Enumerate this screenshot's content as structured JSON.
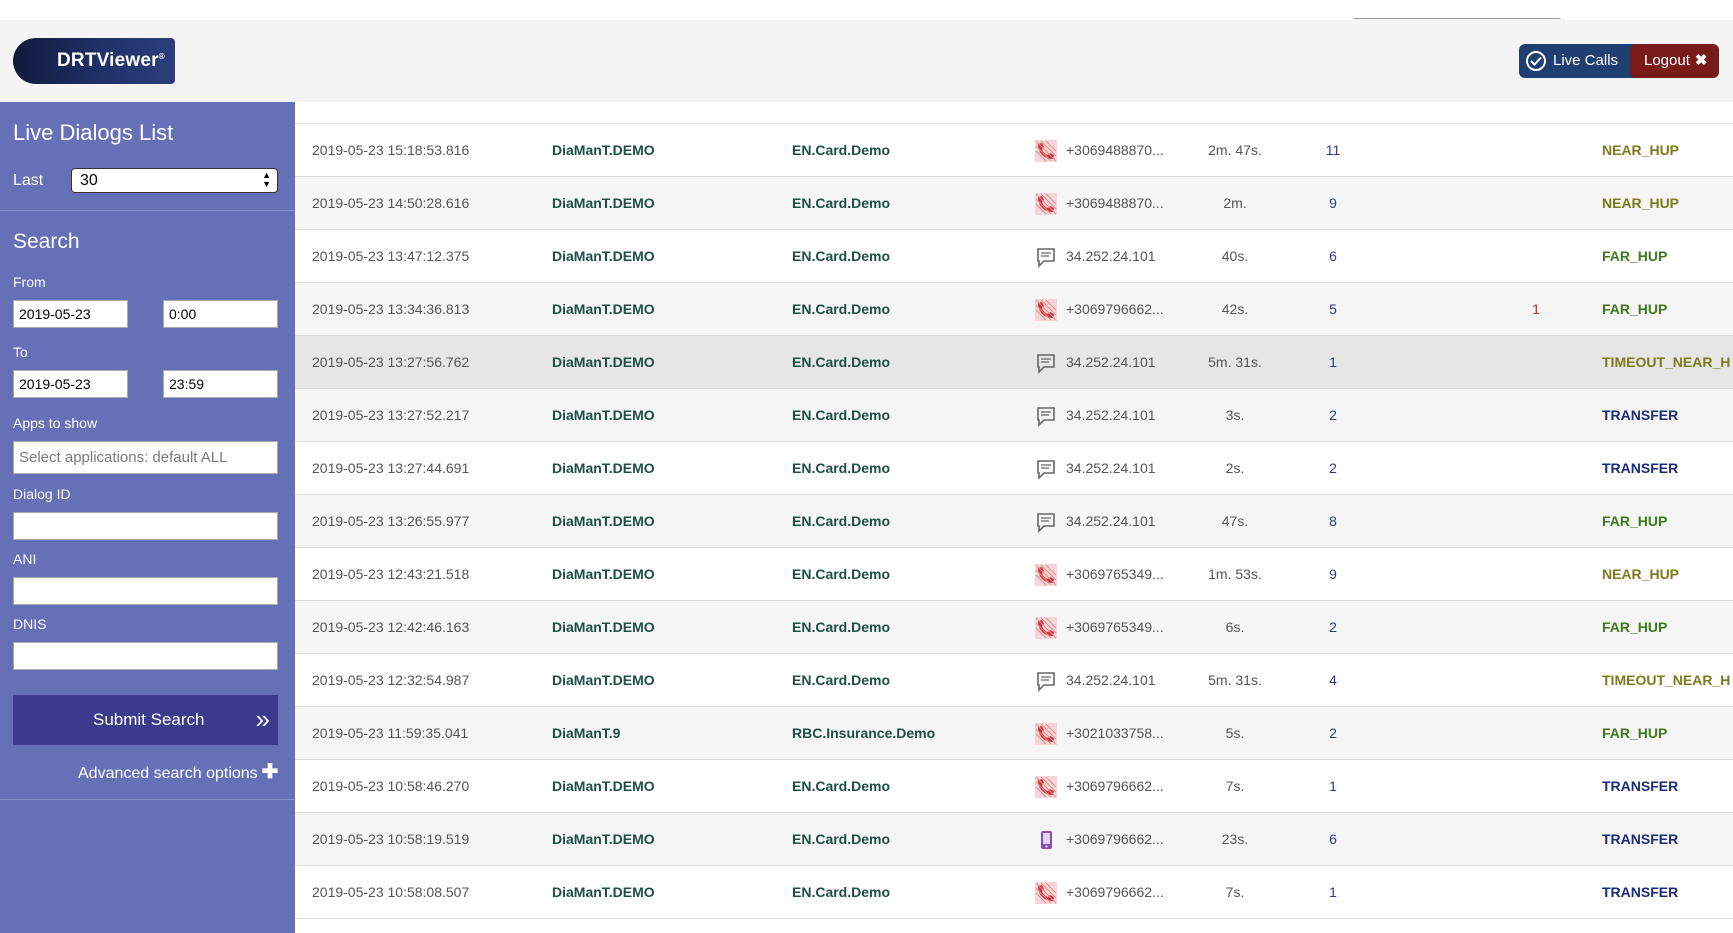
{
  "header": {
    "logo_text": "DRTViewer",
    "logo_mark": "®",
    "live_calls_label": "Live Calls",
    "logout_label": "Logout",
    "logout_icon": "✖"
  },
  "sidebar": {
    "title": "Live Dialogs List",
    "last_label": "Last",
    "last_value": "30",
    "search_title": "Search",
    "from_label": "From",
    "from_date": "2019-05-23",
    "from_time": "0:00",
    "to_label": "To",
    "to_date": "2019-05-23",
    "to_time": "23:59",
    "apps_label": "Apps to show",
    "apps_placeholder": "Select applications: default ALL",
    "dialog_id_label": "Dialog ID",
    "dialog_id_value": "",
    "ani_label": "ANI",
    "ani_value": "",
    "dnis_label": "DNIS",
    "dnis_value": "",
    "submit_label": "Submit Search",
    "submit_icon": "»",
    "advanced_label": "Advanced search options",
    "advanced_icon": "✚"
  },
  "colors": {
    "sidebar_bg": "#6570b6",
    "submit_bg": "#3b3a8c",
    "live_calls_bg": "#1f3f73",
    "logout_bg": "#7a1b1b",
    "system_text": "#1d4f43"
  },
  "rows": [
    {
      "date": "2019-05-23 15:18:53.816",
      "system": "DiaManT.DEMO",
      "app": "EN.Card.Demo",
      "icon": "phone-icon",
      "ani": "+3069488870...",
      "duration": "2m. 47s.",
      "steps": "11",
      "errors": "",
      "end": "NEAR_HUP"
    },
    {
      "date": "2019-05-23 14:50:28.616",
      "system": "DiaManT.DEMO",
      "app": "EN.Card.Demo",
      "icon": "phone-icon",
      "ani": "+3069488870...",
      "duration": "2m.",
      "steps": "9",
      "errors": "",
      "end": "NEAR_HUP"
    },
    {
      "date": "2019-05-23 13:47:12.375",
      "system": "DiaManT.DEMO",
      "app": "EN.Card.Demo",
      "icon": "chat-icon",
      "ani": "34.252.24.101",
      "duration": "40s.",
      "steps": "6",
      "errors": "",
      "end": "FAR_HUP"
    },
    {
      "date": "2019-05-23 13:34:36.813",
      "system": "DiaManT.DEMO",
      "app": "EN.Card.Demo",
      "icon": "phone-icon",
      "ani": "+3069796662...",
      "duration": "42s.",
      "steps": "5",
      "errors": "1",
      "end": "FAR_HUP"
    },
    {
      "date": "2019-05-23 13:27:56.762",
      "system": "DiaManT.DEMO",
      "app": "EN.Card.Demo",
      "icon": "chat-icon",
      "ani": "34.252.24.101",
      "duration": "5m. 31s.",
      "steps": "1",
      "errors": "",
      "end": "TIMEOUT_NEAR_H"
    },
    {
      "date": "2019-05-23 13:27:52.217",
      "system": "DiaManT.DEMO",
      "app": "EN.Card.Demo",
      "icon": "chat-icon",
      "ani": "34.252.24.101",
      "duration": "3s.",
      "steps": "2",
      "errors": "",
      "end": "TRANSFER"
    },
    {
      "date": "2019-05-23 13:27:44.691",
      "system": "DiaManT.DEMO",
      "app": "EN.Card.Demo",
      "icon": "chat-icon",
      "ani": "34.252.24.101",
      "duration": "2s.",
      "steps": "2",
      "errors": "",
      "end": "TRANSFER"
    },
    {
      "date": "2019-05-23 13:26:55.977",
      "system": "DiaManT.DEMO",
      "app": "EN.Card.Demo",
      "icon": "chat-icon",
      "ani": "34.252.24.101",
      "duration": "47s.",
      "steps": "8",
      "errors": "",
      "end": "FAR_HUP"
    },
    {
      "date": "2019-05-23 12:43:21.518",
      "system": "DiaManT.DEMO",
      "app": "EN.Card.Demo",
      "icon": "phone-icon",
      "ani": "+3069765349...",
      "duration": "1m. 53s.",
      "steps": "9",
      "errors": "",
      "end": "NEAR_HUP"
    },
    {
      "date": "2019-05-23 12:42:46.163",
      "system": "DiaManT.DEMO",
      "app": "EN.Card.Demo",
      "icon": "phone-icon",
      "ani": "+3069765349...",
      "duration": "6s.",
      "steps": "2",
      "errors": "",
      "end": "FAR_HUP"
    },
    {
      "date": "2019-05-23 12:32:54.987",
      "system": "DiaManT.DEMO",
      "app": "EN.Card.Demo",
      "icon": "chat-icon",
      "ani": "34.252.24.101",
      "duration": "5m. 31s.",
      "steps": "4",
      "errors": "",
      "end": "TIMEOUT_NEAR_H"
    },
    {
      "date": "2019-05-23 11:59:35.041",
      "system": "DiaManT.9",
      "app": "RBC.Insurance.Demo",
      "icon": "phone-icon",
      "ani": "+3021033758...",
      "duration": "5s.",
      "steps": "2",
      "errors": "",
      "end": "FAR_HUP"
    },
    {
      "date": "2019-05-23 10:58:46.270",
      "system": "DiaManT.DEMO",
      "app": "EN.Card.Demo",
      "icon": "phone-icon",
      "ani": "+3069796662...",
      "duration": "7s.",
      "steps": "1",
      "errors": "",
      "end": "TRANSFER"
    },
    {
      "date": "2019-05-23 10:58:19.519",
      "system": "DiaManT.DEMO",
      "app": "EN.Card.Demo",
      "icon": "mobile-icon",
      "ani": "+3069796662...",
      "duration": "23s.",
      "steps": "6",
      "errors": "",
      "end": "TRANSFER"
    },
    {
      "date": "2019-05-23 10:58:08.507",
      "system": "DiaManT.DEMO",
      "app": "EN.Card.Demo",
      "icon": "phone-icon",
      "ani": "+3069796662...",
      "duration": "7s.",
      "steps": "1",
      "errors": "",
      "end": "TRANSFER"
    }
  ]
}
